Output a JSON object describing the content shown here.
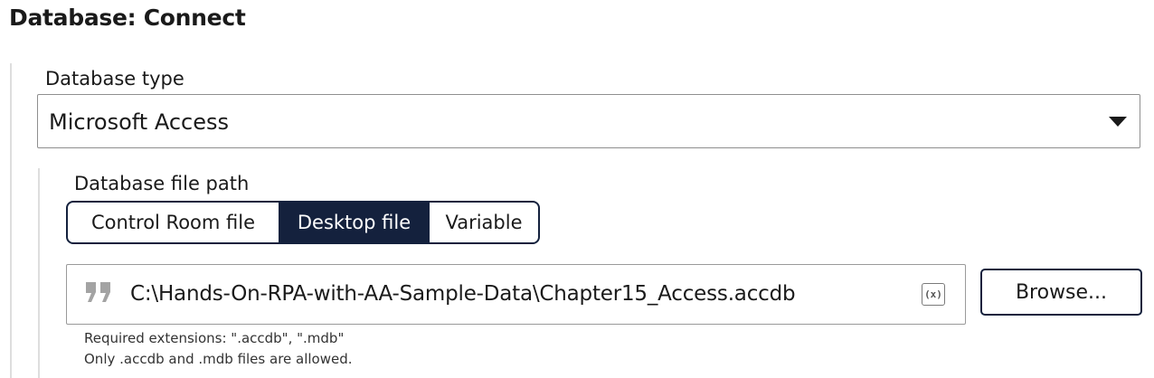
{
  "page": {
    "title": "Database: Connect"
  },
  "database_type": {
    "label": "Database type",
    "selected": "Microsoft Access"
  },
  "file_path": {
    "label": "Database file path",
    "options": [
      "Control Room file",
      "Desktop file",
      "Variable"
    ],
    "active_option": "Desktop file",
    "value": "C:\\Hands-On-RPA-with-AA-Sample-Data\\Chapter15_Access.accdb",
    "variable_icon_text": "(x)",
    "browse_label": "Browse...",
    "hint_extensions": "Required extensions: \".accdb\", \".mdb\"",
    "hint_allowed": "Only .accdb and .mdb files are allowed."
  },
  "colors": {
    "accent_navy": "#14213d",
    "border_gray": "#8f8f8f",
    "rule_gray": "#dedede"
  },
  "icons": {
    "select_caret": "caret-down-icon",
    "input_prefix": "quote-icon",
    "input_suffix": "variable-icon"
  }
}
